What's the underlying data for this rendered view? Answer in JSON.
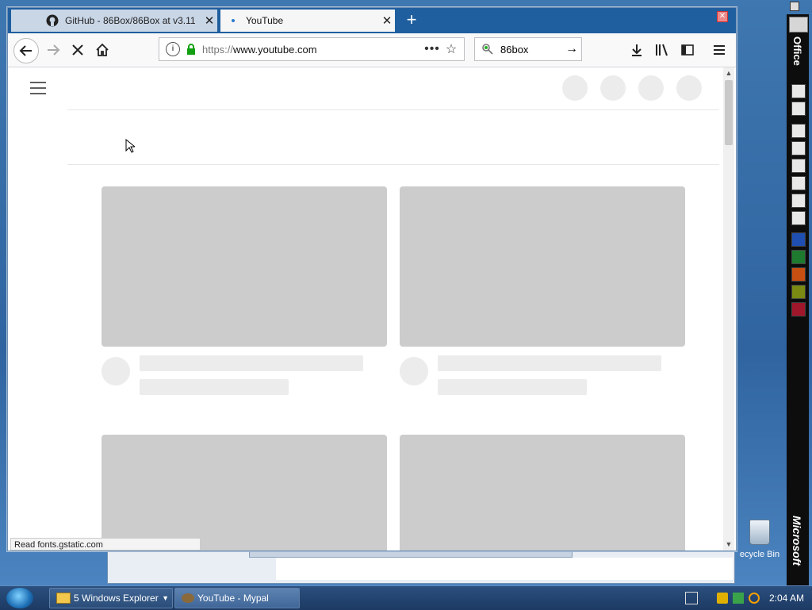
{
  "browser": {
    "tabs": [
      {
        "title": "GitHub - 86Box/86Box at v3.11",
        "active": false,
        "icon": "github-icon"
      },
      {
        "title": "YouTube",
        "active": true,
        "icon": "loading-dot-icon"
      }
    ],
    "url_protocol": "https://",
    "url_rest": "www.youtube.com",
    "search_value": "86box",
    "status_text": "Read fonts.gstatic.com"
  },
  "desktop": {
    "recycle_bin_label": "ecycle Bin",
    "office_bar": {
      "top_label": "Office",
      "bottom_label": "Microsoft"
    }
  },
  "taskbar": {
    "explorer_label": "5 Windows Explorer",
    "browser_label": "YouTube - Mypal",
    "clock": "2:04 AM"
  },
  "colors": {
    "placeholder_thumb": "#cccccc",
    "placeholder_light": "#ececec",
    "tabbar": "#1f5f9f"
  }
}
